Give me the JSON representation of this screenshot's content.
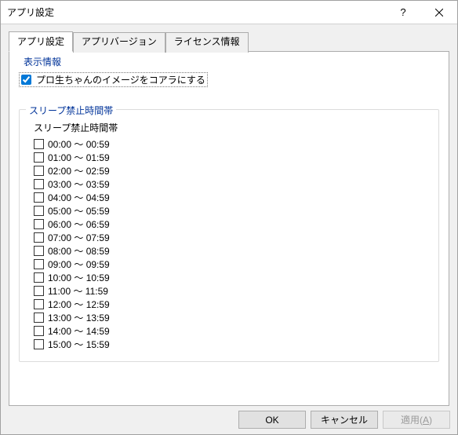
{
  "window": {
    "title": "アプリ設定"
  },
  "tabs": {
    "t0": "アプリ設定",
    "t1": "アプリバージョン",
    "t2": "ライセンス情報"
  },
  "group1": {
    "label": "表示情報",
    "checkbox_label": "プロ生ちゃんのイメージをコアラにする"
  },
  "group2": {
    "label": "スリープ禁止時間帯",
    "list_header": "スリープ禁止時間帯",
    "items": [
      "00:00 ～ 00:59",
      "01:00 ～ 01:59",
      "02:00 ～ 02:59",
      "03:00 ～ 03:59",
      "04:00 ～ 04:59",
      "05:00 ～ 05:59",
      "06:00 ～ 06:59",
      "07:00 ～ 07:59",
      "08:00 ～ 08:59",
      "09:00 ～ 09:59",
      "10:00 ～ 10:59",
      "11:00 ～ 11:59",
      "12:00 ～ 12:59",
      "13:00 ～ 13:59",
      "14:00 ～ 14:59",
      "15:00 ～ 15:59"
    ]
  },
  "buttons": {
    "ok": "OK",
    "cancel": "キャンセル",
    "apply_prefix": "適用(",
    "apply_key": "A",
    "apply_suffix": ")"
  }
}
